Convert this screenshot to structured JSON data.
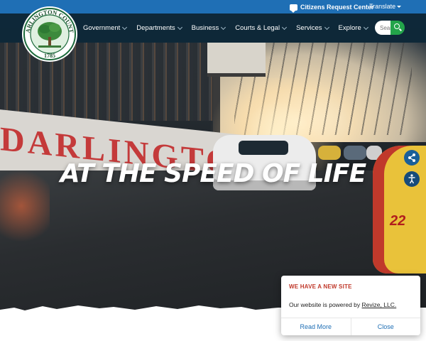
{
  "topbar": {
    "citizens_label": "Citizens Request Center",
    "translate_label": "Translate"
  },
  "seal": {
    "name": "DARLINGTON COUNTY",
    "year": "1785"
  },
  "nav": {
    "items": [
      {
        "label": "Government"
      },
      {
        "label": "Departments"
      },
      {
        "label": "Business"
      },
      {
        "label": "Courts & Legal"
      },
      {
        "label": "Services"
      },
      {
        "label": "Explore"
      }
    ]
  },
  "search": {
    "placeholder": "Search"
  },
  "hero": {
    "wall_text": "DARLINGTON",
    "car_number": "22",
    "tagline": "AT THE SPEED OF LIFE"
  },
  "popup": {
    "title": "WE HAVE A NEW SITE",
    "message_prefix": "Our website is powered by ",
    "message_link": "Revize, LLC.",
    "read_more": "Read More",
    "close": "Close"
  },
  "colors": {
    "topbar": "#1f6fb5",
    "navbar": "#0c2738",
    "search_button": "#23a44a",
    "popup_title": "#c0392b"
  },
  "icons": [
    "chat-icon",
    "caret-down-icon",
    "chevron-down-icon",
    "search-icon",
    "share-icon",
    "accessibility-icon"
  ]
}
